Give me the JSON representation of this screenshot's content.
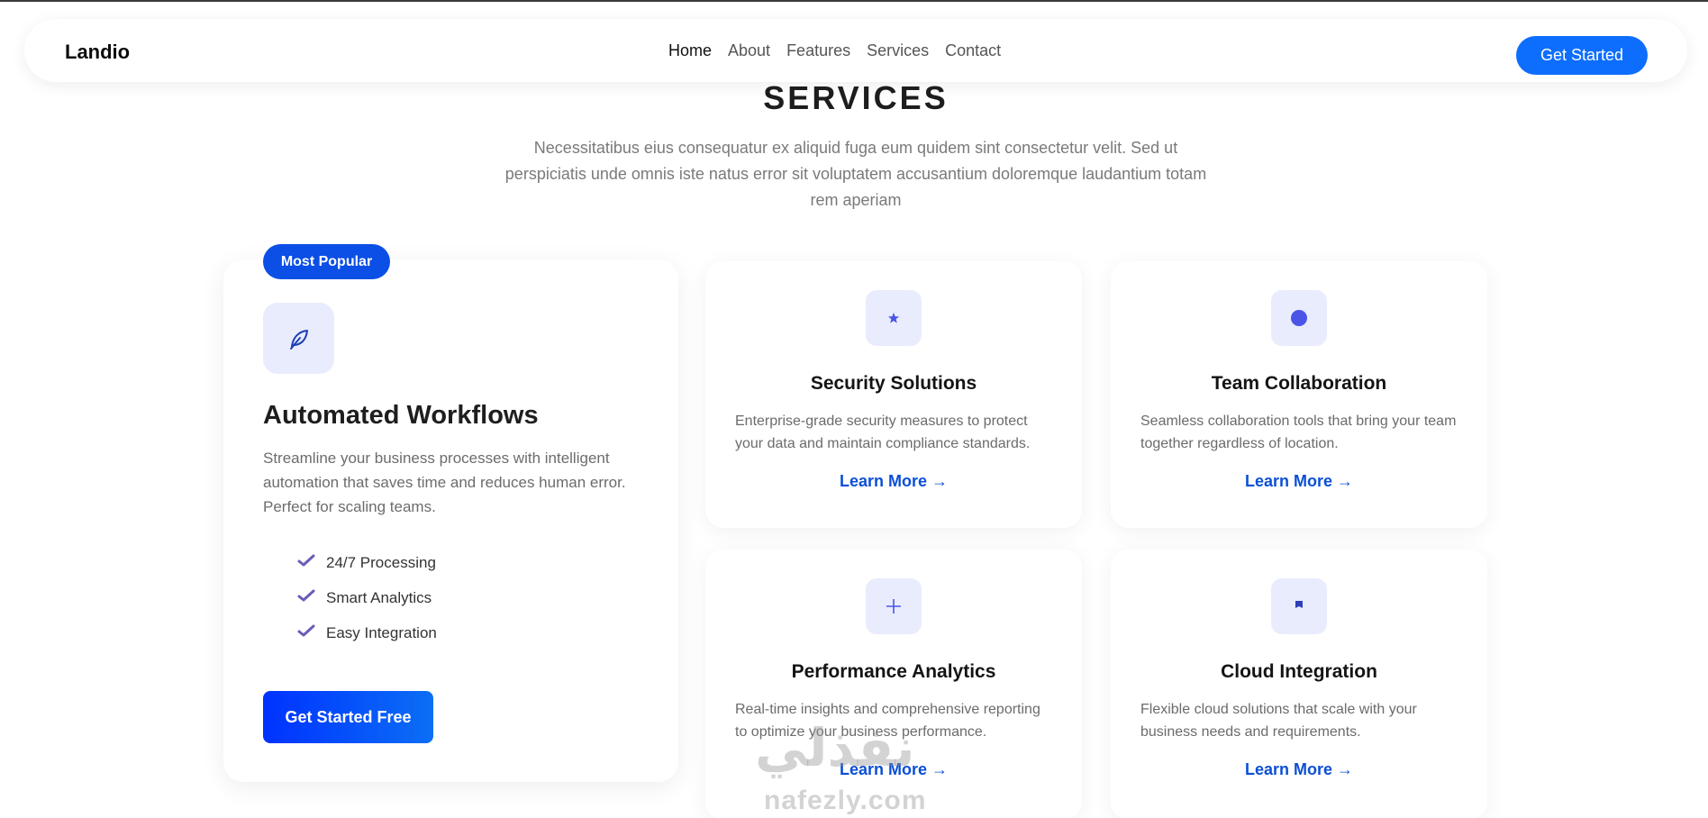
{
  "header": {
    "logo": "Landio",
    "nav": [
      {
        "label": "Home",
        "active": true
      },
      {
        "label": "About",
        "active": false
      },
      {
        "label": "Features",
        "active": false
      },
      {
        "label": "Services",
        "active": false
      },
      {
        "label": "Contact",
        "active": false
      }
    ],
    "cta_label": "Get Started"
  },
  "section": {
    "title": "SERVICES",
    "description": "Necessitatibus eius consequatur ex aliquid fuga eum quidem sint consectetur velit. Sed ut perspiciatis unde omnis iste natus error sit voluptatem accusantium doloremque laudantium totam rem aperiam"
  },
  "featured": {
    "badge": "Most Popular",
    "icon": "leaf-icon",
    "title": "Automated Workflows",
    "description": "Streamline your business processes with intelligent automation that saves time and reduces human error. Perfect for scaling teams.",
    "features": [
      "24/7 Processing",
      "Smart Analytics",
      "Easy Integration"
    ],
    "cta_label": "Get Started Free"
  },
  "services": [
    {
      "icon": "star-icon",
      "title": "Security Solutions",
      "description": "Enterprise-grade security measures to protect your data and maintain compliance standards.",
      "link": "Learn More →"
    },
    {
      "icon": "circle-icon",
      "title": "Team Collaboration",
      "description": "Seamless collaboration tools that bring your team together regardless of location.",
      "link": "Learn More →"
    },
    {
      "icon": "plus-icon",
      "title": "Performance Analytics",
      "description": "Real-time insights and comprehensive reporting to optimize your business performance.",
      "link": "Learn More →"
    },
    {
      "icon": "flag-icon",
      "title": "Cloud Integration",
      "description": "Flexible cloud solutions that scale with your business needs and requirements.",
      "link": "Learn More →"
    }
  ],
  "watermark": {
    "arabic": "نفذلي",
    "latin": "nafezly.com"
  },
  "colors": {
    "primary": "#0d6efd",
    "badge": "#0b4fe6",
    "icon_bg": "#e8ecfd",
    "icon_fg": "#4a55e8",
    "check": "#6b5bb5"
  }
}
